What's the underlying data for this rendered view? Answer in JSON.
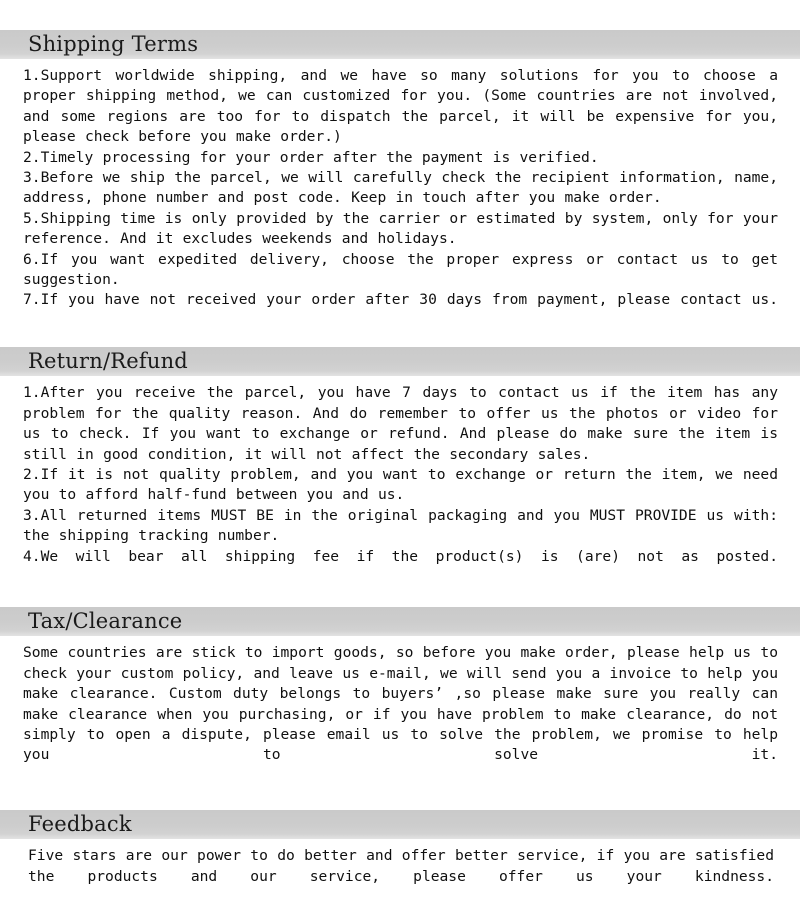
{
  "document": {
    "type": "shipping-policy-panel",
    "background_color": "#ffffff",
    "header_band_color": "#cdcdcd",
    "text_color": "#101010"
  },
  "sections": [
    {
      "id": "shipping-terms",
      "title": "Shipping Terms",
      "body": "1.Support worldwide shipping, and we have so many solutions for you to choose a proper shipping method, we can customized for you. (Some countries are not involved, and some regions are too for to dispatch the parcel, it will be expensive for you, please check before you make order.)\n2.Timely processing for your order after the payment is verified.\n3.Before we ship the parcel, we will carefully check the recipient information, name, address, phone number and post code. Keep in touch after you make order.\n5.Shipping time is only provided by the carrier or estimated by system, only for your reference. And it excludes weekends and holidays.\n6.If you want expedited delivery, choose the proper express or contact us to get suggestion.\n7.If you have not received your order after 30 days from payment, please contact us."
    },
    {
      "id": "return-refund",
      "title": "Return/Refund",
      "body": "1.After you receive the parcel, you have 7 days to contact us if the item has any problem for the quality reason. And do remember to offer us the photos or video for us to check. If you want to exchange or refund. And please do make sure the item is still in good condition, it will not affect the secondary sales.\n2.If it is not quality problem, and you want to exchange or return the item, we need you to afford half-fund between you and us.\n3.All returned items MUST BE in the original packaging and you MUST PROVIDE us with: the shipping tracking number.\n4.We will bear all shipping fee if the product(s) is (are) not as posted."
    },
    {
      "id": "tax-clearance",
      "title": "Tax/Clearance",
      "body": "Some countries are stick to import goods, so before you make order, please help us to check your custom policy, and leave us e-mail, we will send you a invoice to help you make clearance. Custom duty belongs to buyers’ ,so please make sure you really can make clearance when you purchasing, or if you have problem to make clearance, do not simply to open a dispute, please email us to solve the problem, we promise to help you to solve it."
    },
    {
      "id": "feedback",
      "title": "Feedback",
      "body": "Five stars are our power to do better and offer better service, if you are satisfied the products and our service, please offer us your kindness."
    }
  ]
}
